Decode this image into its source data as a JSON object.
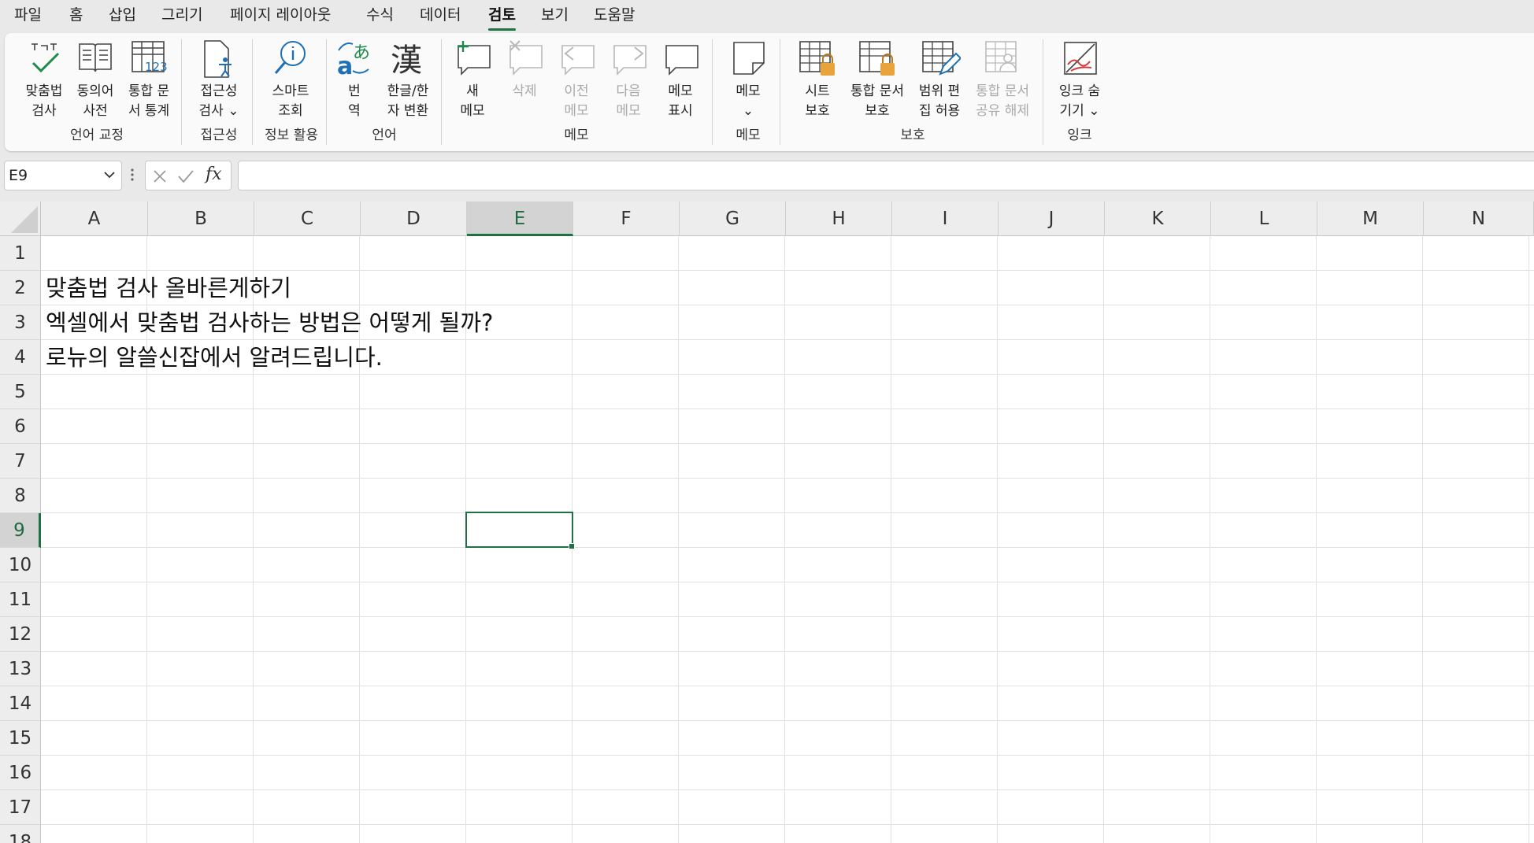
{
  "menu": {
    "file": "파일",
    "home": "홈",
    "insert": "삽입",
    "draw": "그리기",
    "page_layout": "페이지 레이아웃",
    "formulas": "수식",
    "data": "데이터",
    "review": "검토",
    "view": "보기",
    "help": "도움말"
  },
  "ribbon": {
    "spelling": [
      "맞춤법",
      "검사"
    ],
    "thesaurus": [
      "동의어",
      "사전"
    ],
    "workbook_stats": [
      "통합 문",
      "서 통계"
    ],
    "check_accessibility": [
      "접근성",
      "검사 ⌄"
    ],
    "smart_lookup": [
      "스마트",
      "조회"
    ],
    "translate": [
      "번",
      "역"
    ],
    "hangul_hanja": [
      "한글/한",
      "자 변환"
    ],
    "new_comment": [
      "새",
      "메모"
    ],
    "delete_comment": [
      "삭제",
      ""
    ],
    "previous_comment": [
      "이전",
      "메모"
    ],
    "next_comment": [
      "다음",
      "메모"
    ],
    "show_comments": [
      "메모",
      "표시"
    ],
    "notes": [
      "메모",
      "⌄"
    ],
    "protect_sheet": [
      "시트",
      "보호"
    ],
    "protect_workbook": [
      "통합 문서",
      "보호"
    ],
    "allow_edit_ranges": [
      "범위 편",
      "집 허용"
    ],
    "unshare_workbook": [
      "통합 문서",
      "공유 해제"
    ],
    "hide_ink": [
      "잉크 숨",
      "기기 ⌄"
    ],
    "groups": {
      "proofing": "언어 교정",
      "accessibility": "접근성",
      "insights": "정보 활용",
      "language": "언어",
      "comments": "메모",
      "notes": "메모",
      "protect": "보호",
      "ink": "잉크"
    }
  },
  "formula_bar": {
    "name_box": "E9",
    "fx": "fx",
    "formula": ""
  },
  "sheet": {
    "columns": [
      "A",
      "B",
      "C",
      "D",
      "E",
      "F",
      "G",
      "H",
      "I",
      "J",
      "K",
      "L",
      "M",
      "N"
    ],
    "rows": [
      "1",
      "2",
      "3",
      "4",
      "5",
      "6",
      "7",
      "8",
      "9",
      "10",
      "11",
      "12",
      "13",
      "14",
      "15",
      "16",
      "17",
      "18"
    ],
    "selected_cell": "E9",
    "cells": {
      "A2": "맞춤법 검사 올바른게하기",
      "A3": "엑셀에서 맞춤법 검사하는 방법은 어떻게 될까?",
      "A4": "로뉴의 알쓸신잡에서 알려드립니다."
    }
  },
  "colors": {
    "accent": "#1e7145",
    "icon_blue": "#1f6fb5",
    "lock": "#e8a33d",
    "ink_red": "#d23b3b"
  }
}
